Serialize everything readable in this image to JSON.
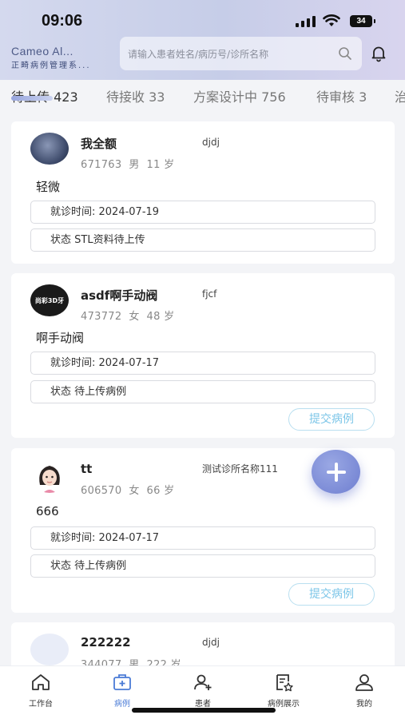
{
  "status_bar": {
    "time": "09:06",
    "battery": "34"
  },
  "brand": {
    "name_en": "Cameo Al...",
    "name_cn": "正畸病例管理系..."
  },
  "search": {
    "placeholder": "请输入患者姓名/病历号/诊所名称"
  },
  "tabs": [
    {
      "label": "待上传 423",
      "active": true
    },
    {
      "label": "待接收 33"
    },
    {
      "label": "方案设计中 756"
    },
    {
      "label": "待审核 3"
    },
    {
      "label": "治"
    }
  ],
  "cases": [
    {
      "name": "我全额",
      "clinic": "djdj",
      "id": "671763",
      "gender": "男",
      "age": "11 岁",
      "diagnosis": "轻微",
      "visit": "就诊时间: 2024-07-19",
      "status": "状态 STL资料待上传",
      "avatar": "photo-avatar"
    },
    {
      "name": "asdf啊手动阀",
      "clinic": "fjcf",
      "id": "473772",
      "gender": "女",
      "age": "48 岁",
      "diagnosis": "啊手动阀",
      "visit": "就诊时间: 2024-07-17",
      "status": "状态 待上传病例",
      "submit": "提交病例",
      "avatar_text": "尚彩3D牙"
    },
    {
      "name": "tt",
      "clinic": "测试诊所名称111",
      "id": "606570",
      "gender": "女",
      "age": "66 岁",
      "diagnosis": "666",
      "visit": "就诊时间: 2024-07-17",
      "status": "状态 待上传病例",
      "submit": "提交病例",
      "avatar": "cartoon-avatar"
    },
    {
      "name": "222222",
      "clinic": "djdj",
      "id": "344077",
      "gender": "男",
      "age": "222 岁",
      "avatar": "placeholder-avatar"
    }
  ],
  "bottom_nav": [
    {
      "label": "工作台",
      "icon": "home-icon"
    },
    {
      "label": "病例",
      "icon": "medical-case-icon",
      "active": true
    },
    {
      "label": "患者",
      "icon": "add-user-icon"
    },
    {
      "label": "病例展示",
      "icon": "case-showcase-icon"
    },
    {
      "label": "我的",
      "icon": "profile-icon"
    }
  ],
  "colors": {
    "accent": "#4a7bd6",
    "submit": "#7dc6e8",
    "fab": "#7b8ad6"
  }
}
